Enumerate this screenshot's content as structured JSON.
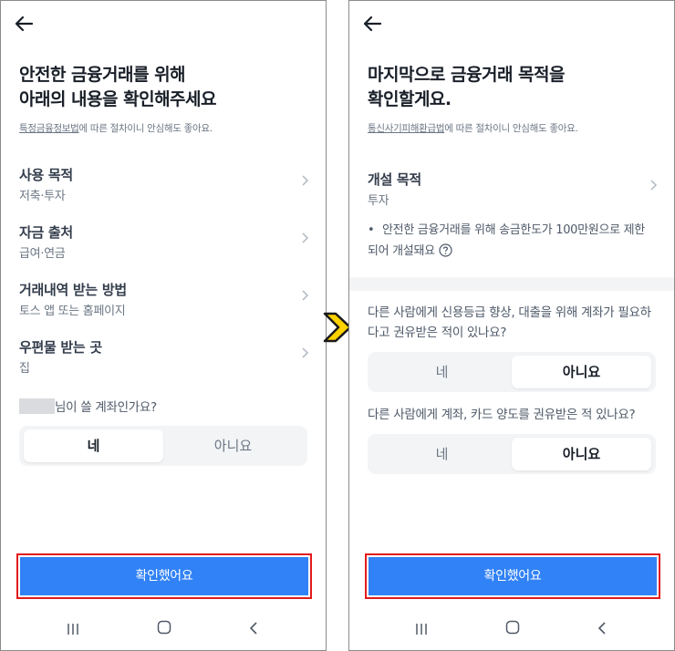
{
  "left": {
    "title_line1": "안전한 금융거래를 위해",
    "title_line2": "아래의 내용을 확인해주세요",
    "subtitle_link": "특정금융정보법",
    "subtitle_rest": "에 따른 절차이니 안심해도 좋아요.",
    "rows": [
      {
        "label": "사용 목적",
        "value": "저축·투자"
      },
      {
        "label": "자금 출처",
        "value": "급여·연금"
      },
      {
        "label": "거래내역 받는 방법",
        "value": "토스 앱 또는 홈페이지"
      },
      {
        "label": "우편물 받는 곳",
        "value": "집"
      }
    ],
    "question_suffix": "님이 쓸 계좌인가요?",
    "toggle": {
      "yes": "네",
      "no": "아니요",
      "selected": "yes"
    },
    "confirm_label": "확인했어요"
  },
  "right": {
    "title_line1": "마지막으로 금융거래 목적을",
    "title_line2": "확인할게요.",
    "subtitle_link": "통신사기피해환급법",
    "subtitle_rest": "에 따른 절차이니 안심해도 좋아요.",
    "purpose": {
      "label": "개설 목적",
      "value": "투자"
    },
    "notice": "안전한 금융거래를 위해 송금한도가 100만원으로 제한되어 개설돼요",
    "bullet": "•",
    "q1": "다른 사람에게 신용등급 향상, 대출을 위해 계좌가 필요하다고 권유받은 적이 있나요?",
    "q1_toggle": {
      "yes": "네",
      "no": "아니요",
      "selected": "no"
    },
    "q2": "다른 사람에게 계좌, 카드 양도를 권유받은 적 있나요?",
    "q2_toggle": {
      "yes": "네",
      "no": "아니요",
      "selected": "no"
    },
    "confirm_label": "확인했어요"
  },
  "colors": {
    "accent": "#3182f6",
    "highlight": "#e21b1b",
    "arrow": "#ffd200",
    "segment_bg": "#f2f4f6"
  },
  "icons": [
    "back-arrow-icon",
    "chevron-right-icon",
    "help-circle-icon",
    "nav-recent-apps-icon",
    "nav-home-icon",
    "nav-back-icon",
    "next-step-arrow-icon"
  ]
}
